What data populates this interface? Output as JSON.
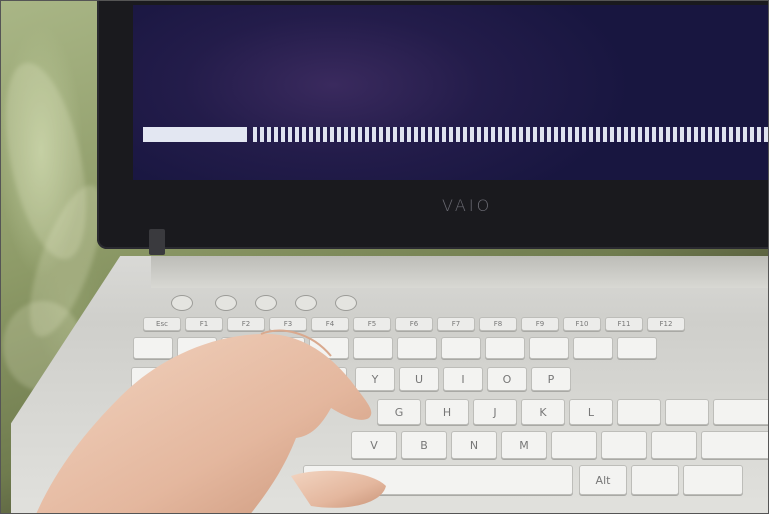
{
  "screen": {
    "progress_fraction": 0.16,
    "colors": {
      "screen": "#1c1846",
      "bar": "#e3e7f2"
    }
  },
  "laptop": {
    "brand": "VAIO"
  },
  "keyboard": {
    "function_row": [
      "Esc",
      "F1",
      "F2",
      "F3",
      "F4",
      "F5",
      "F6",
      "F7",
      "F8",
      "F9",
      "F10",
      "F11",
      "F12"
    ],
    "row_top": [
      "Y",
      "U",
      "I",
      "O",
      "P"
    ],
    "row_home": [
      "G",
      "H",
      "J",
      "K",
      "L"
    ],
    "row_bottom": [
      "V",
      "B",
      "N",
      "M"
    ],
    "alt_label": "Alt"
  }
}
